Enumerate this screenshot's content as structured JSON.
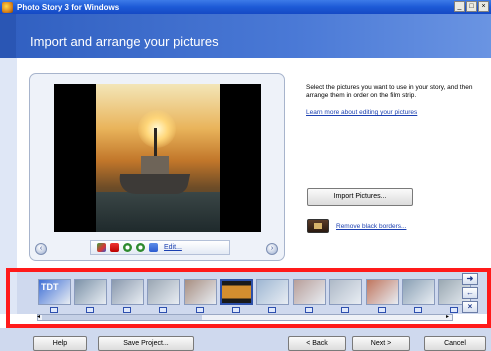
{
  "window": {
    "title": "Photo Story 3 for Windows",
    "minimize": "_",
    "maximize": "□",
    "close": "×"
  },
  "header": {
    "title": "Import and arrange your pictures"
  },
  "preview": {
    "prev_glyph": "‹",
    "next_glyph": "›",
    "edit_label": "Edit..."
  },
  "instructions": {
    "text": "Select the pictures you want to use in your story, and then arrange them in order on the film strip.",
    "learn_link": "Learn more about editing your pictures"
  },
  "actions": {
    "import_button": "Import Pictures...",
    "remove_borders": "Remove black borders..."
  },
  "filmstrip": {
    "thumbnails": [
      {
        "label": "TDT",
        "color": "#3f6fd6"
      },
      {
        "color": "#7c92a8"
      },
      {
        "color": "#8a99ad"
      },
      {
        "color": "#9aa6b3"
      },
      {
        "color": "#a88f82"
      },
      {
        "color": "#d48e2f"
      },
      {
        "color": "#9fb7d3"
      },
      {
        "color": "#b89f9a"
      },
      {
        "color": "#aeb9c7"
      },
      {
        "color": "#c0765e"
      },
      {
        "color": "#8aa0b4"
      },
      {
        "color": "#9aa8b2"
      }
    ],
    "selected_index": 5,
    "side_buttons": [
      "➜",
      "←",
      "×"
    ],
    "scroll_left": "◂",
    "scroll_right": "▸"
  },
  "bottom": {
    "help": "Help",
    "save_project": "Save Project...",
    "back": "< Back",
    "next": "Next >",
    "cancel": "Cancel"
  },
  "colors": {
    "highlight": "#ff1a1a",
    "header": "#305fc0",
    "link": "#1a3fb0"
  }
}
